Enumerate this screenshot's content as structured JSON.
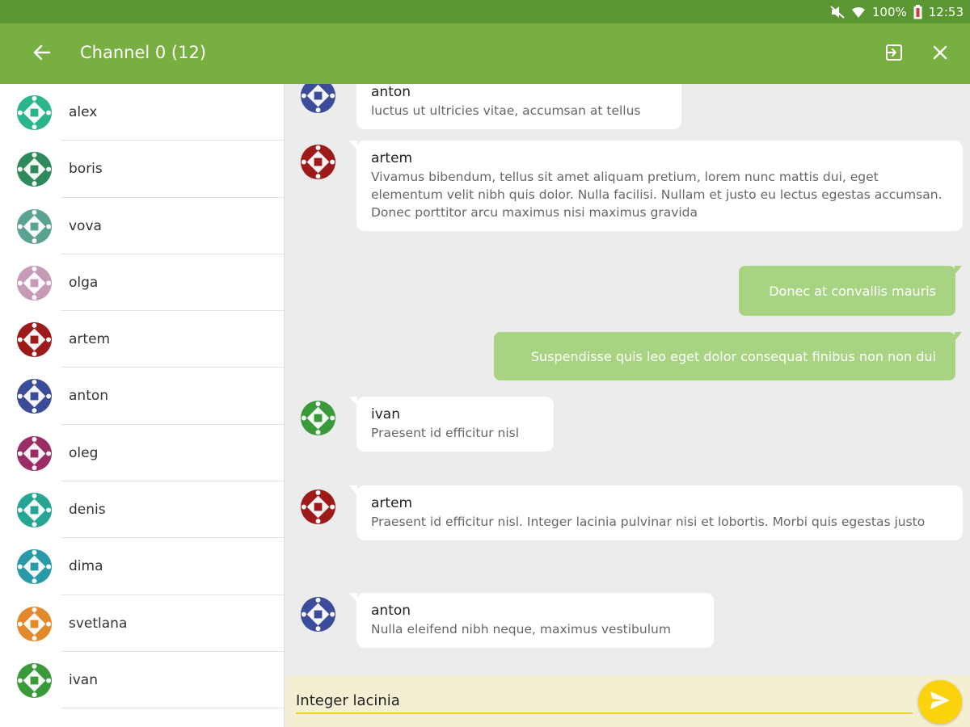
{
  "status_bar": {
    "battery": "100%",
    "time": "12:53"
  },
  "app_bar": {
    "title": "Channel 0 (12)"
  },
  "colors": {
    "status_bar": "#5a9631",
    "app_bar": "#77b041",
    "own_bubble": "#a8d383",
    "composer_bg": "#f4eed2",
    "send_button": "#fbd20b"
  },
  "users": [
    {
      "name": "alex",
      "color": "#2bb58c"
    },
    {
      "name": "boris",
      "color": "#2e8a5a"
    },
    {
      "name": "vova",
      "color": "#5aa392"
    },
    {
      "name": "olga",
      "color": "#c79bb7"
    },
    {
      "name": "artem",
      "color": "#9c1a1a"
    },
    {
      "name": "anton",
      "color": "#3a4c9a"
    },
    {
      "name": "oleg",
      "color": "#9a2d66"
    },
    {
      "name": "denis",
      "color": "#27a594"
    },
    {
      "name": "dima",
      "color": "#2a9aa8"
    },
    {
      "name": "svetlana",
      "color": "#e3892b"
    },
    {
      "name": "ivan",
      "color": "#3a9a3a"
    }
  ],
  "messages": [
    {
      "author": "anton",
      "text": "luctus ut ultricies vitae, accumsan at tellus",
      "color": "#3a4c9a"
    },
    {
      "author": "artem",
      "text": "Vivamus bibendum, tellus sit amet aliquam pretium, lorem nunc mattis dui, eget elementum velit nibh quis dolor. Nulla facilisi. Nullam et justo eu lectus egestas accumsan. Donec porttitor arcu maximus nisi maximus gravida",
      "color": "#9c1a1a"
    },
    {
      "own": true,
      "text": "Donec at convallis mauris"
    },
    {
      "own": true,
      "text": "Suspendisse quis leo eget dolor consequat finibus non non dui"
    },
    {
      "author": "ivan",
      "text": "Praesent id efficitur nisl",
      "color": "#3a9a3a"
    },
    {
      "author": "artem",
      "text": "Praesent id efficitur nisl. Integer lacinia pulvinar nisi et lobortis. Morbi quis egestas justo",
      "color": "#9c1a1a"
    },
    {
      "author": "anton",
      "text": "Nulla eleifend nibh neque, maximus vestibulum",
      "color": "#3a4c9a"
    }
  ],
  "composer": {
    "value": "Integer lacinia"
  }
}
